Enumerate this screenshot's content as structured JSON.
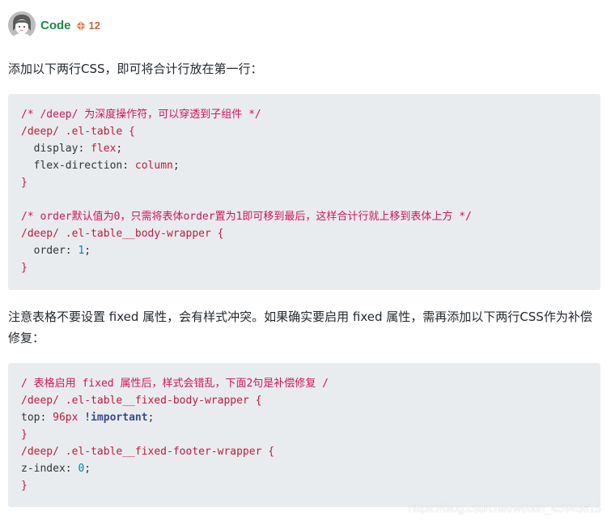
{
  "author": {
    "name": "Code",
    "rank": "12",
    "rank_icon": "rank-diamond-icon"
  },
  "paragraph1": "添加以下两行CSS，即可将合计行放在第一行：",
  "code1": {
    "line1_comment": "/* /deep/ 为深度操作符，可以穿透到子组件 */",
    "line2_selector": "/deep/ .el-table {",
    "line3_prop": "display",
    "line3_val": "flex",
    "line4_prop": "flex-direction",
    "line4_val": "column",
    "line5_close": "}",
    "line7_comment": "/* order默认值为0，只需将表体order置为1即可移到最后，这样合计行就上移到表体上方 */",
    "line8_selector": "/deep/ .el-table__body-wrapper {",
    "line9_prop": "order",
    "line9_val": "1",
    "line10_close": "}"
  },
  "paragraph2": "注意表格不要设置 fixed 属性，会有样式冲突。如果确实要启用 fixed 属性，需再添加以下两行CSS作为补偿修复：",
  "code2": {
    "line1_comment": "/ 表格启用 fixed 属性后，样式会错乱，下面2句是补偿修复 /",
    "line2_selector": "/deep/ .el-table__fixed-body-wrapper {",
    "line3_prop": "top",
    "line3_val": "96px",
    "line3_imp": "!important",
    "line4_close": "}",
    "line5_selector": "/deep/ .el-table__fixed-footer-wrapper {",
    "line6_prop": "z-index",
    "line6_val": "0",
    "line7_close": "}"
  },
  "watermark": "https://blog.csdn.net/weixin_45945615"
}
